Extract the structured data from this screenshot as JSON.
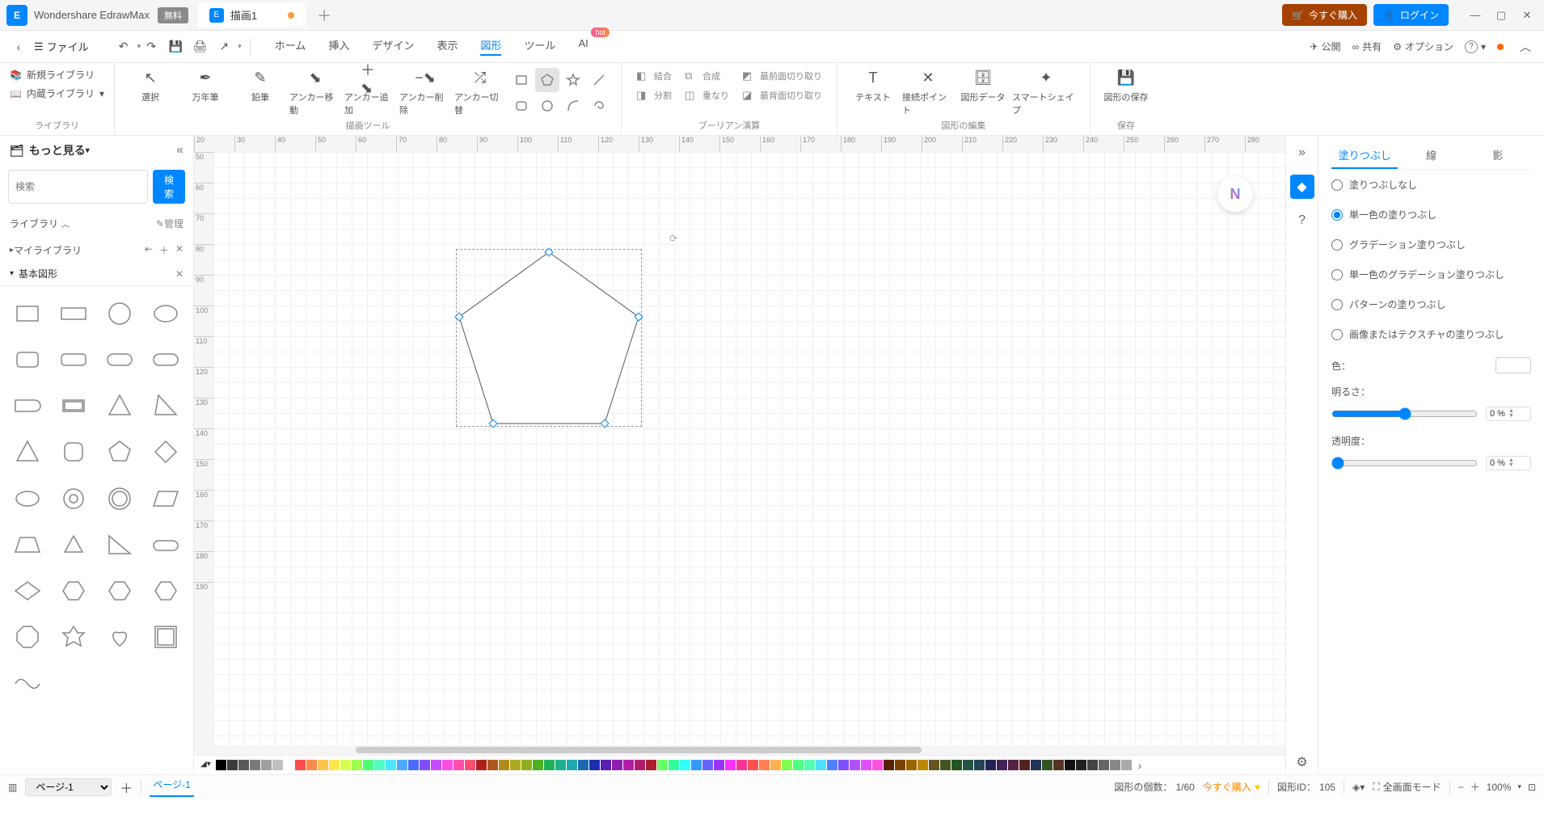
{
  "app": {
    "name": "Wondershare EdrawMax",
    "free_badge": "無料"
  },
  "tabs": {
    "doc_name": "描画1"
  },
  "titlebar": {
    "buy_now": "今すぐ購入",
    "login": "ログイン"
  },
  "file_menu": "ファイル",
  "menu": {
    "home": "ホーム",
    "insert": "挿入",
    "design": "デザイン",
    "view": "表示",
    "shape": "図形",
    "tools": "ツール",
    "ai": "AI",
    "hot": "hot"
  },
  "right_menu": {
    "publish": "公開",
    "share": "共有",
    "options": "オプション"
  },
  "ribbon": {
    "library": {
      "new_lib": "新規ライブラリ",
      "builtin_lib": "内蔵ライブラリ",
      "group": "ライブラリ"
    },
    "drawing": {
      "select": "選択",
      "fountain_pen": "万年筆",
      "pencil": "鉛筆",
      "anchor_move": "アンカー移動",
      "anchor_add": "アンカー追加",
      "anchor_delete": "アンカー削除",
      "anchor_switch": "アンカー切替",
      "group": "描画ツール"
    },
    "boolean": {
      "union": "結合",
      "compose": "合成",
      "front_crop": "最前面切り取り",
      "split": "分割",
      "overlap": "重なり",
      "back_crop": "最背面切り取り",
      "group": "ブーリアン演算"
    },
    "edit": {
      "text": "テキスト",
      "conn_point": "接続ポイント",
      "shape_data": "図形データ",
      "smart_shape": "スマートシェイプ",
      "group": "図形の編集"
    },
    "save": {
      "save_shape": "図形の保存",
      "group": "保存"
    }
  },
  "sidebar": {
    "more": "もっと見る",
    "search_placeholder": "検索",
    "search_btn": "検索",
    "library": "ライブラリ",
    "manage": "管理",
    "my_library": "マイライブラリ",
    "basic_shapes": "基本図形"
  },
  "ruler_h": [
    "20",
    "30",
    "40",
    "50",
    "60",
    "70",
    "80",
    "90",
    "100",
    "110",
    "120",
    "130",
    "140",
    "150",
    "160",
    "170",
    "180",
    "190",
    "200",
    "210",
    "220",
    "230",
    "240",
    "250",
    "260",
    "270",
    "280"
  ],
  "ruler_v": [
    "50",
    "60",
    "70",
    "80",
    "90",
    "100",
    "110",
    "120",
    "130",
    "140",
    "150",
    "160",
    "170",
    "180",
    "190"
  ],
  "right_panel": {
    "tabs": {
      "fill": "塗りつぶし",
      "line": "線",
      "shadow": "影"
    },
    "fill": {
      "none": "塗りつぶしなし",
      "single": "単一色の塗りつぶし",
      "gradient": "グラデーション塗りつぶし",
      "single_gradient": "単一色のグラデーション塗りつぶし",
      "pattern": "パターンの塗りつぶし",
      "image": "画像またはテクスチャの塗りつぶし"
    },
    "color_label": "色：",
    "brightness_label": "明るさ：",
    "brightness_value": "0 %",
    "opacity_label": "透明度：",
    "opacity_value": "0 %"
  },
  "palette": [
    "#000000",
    "#3b3b3b",
    "#595959",
    "#7a7a7a",
    "#a0a0a0",
    "#c0c0c0",
    "#ffffff",
    "#ff4d4d",
    "#ff884d",
    "#ffc34d",
    "#ffe74d",
    "#d6ff4d",
    "#9eff4d",
    "#4dff73",
    "#4dffc3",
    "#4de7ff",
    "#4daaff",
    "#4d6aff",
    "#804dff",
    "#c34dff",
    "#ff4de7",
    "#ff4daa",
    "#ff4d73",
    "#b01e1e",
    "#b0571e",
    "#b08c1e",
    "#b0a81e",
    "#8cb01e",
    "#4db01e",
    "#1eb057",
    "#1eb08c",
    "#1ea8b0",
    "#1e6ab0",
    "#1e2eb0",
    "#571eb0",
    "#8c1eb0",
    "#b01ea8",
    "#b01e6a",
    "#b01e2e",
    "#66ff66",
    "#33ff99",
    "#33ffff",
    "#3399ff",
    "#6666ff",
    "#9933ff",
    "#ff33ff",
    "#ff3399",
    "#ff5050",
    "#ff8050",
    "#ffb050",
    "#80ff50",
    "#50ff80",
    "#50ffb0",
    "#50e0ff",
    "#5080ff",
    "#8050ff",
    "#b050ff",
    "#e050ff",
    "#ff50e0",
    "#552200",
    "#774400",
    "#996600",
    "#bb8800",
    "#665522",
    "#445522",
    "#225522",
    "#225544",
    "#224455",
    "#222255",
    "#442255",
    "#552244",
    "#552222",
    "#223355",
    "#335522",
    "#553322",
    "#111111",
    "#222222",
    "#444444",
    "#666666",
    "#888888",
    "#aaaaaa"
  ],
  "status": {
    "page_label": "ページ-1",
    "page_tab": "ページ-1",
    "shape_count_label": "図形の個数：",
    "shape_count": "1/60",
    "buy_now": "今すぐ購入",
    "shape_id_label": "図形ID：",
    "shape_id": "105",
    "fullscreen": "全画面モード",
    "zoom": "100%"
  }
}
